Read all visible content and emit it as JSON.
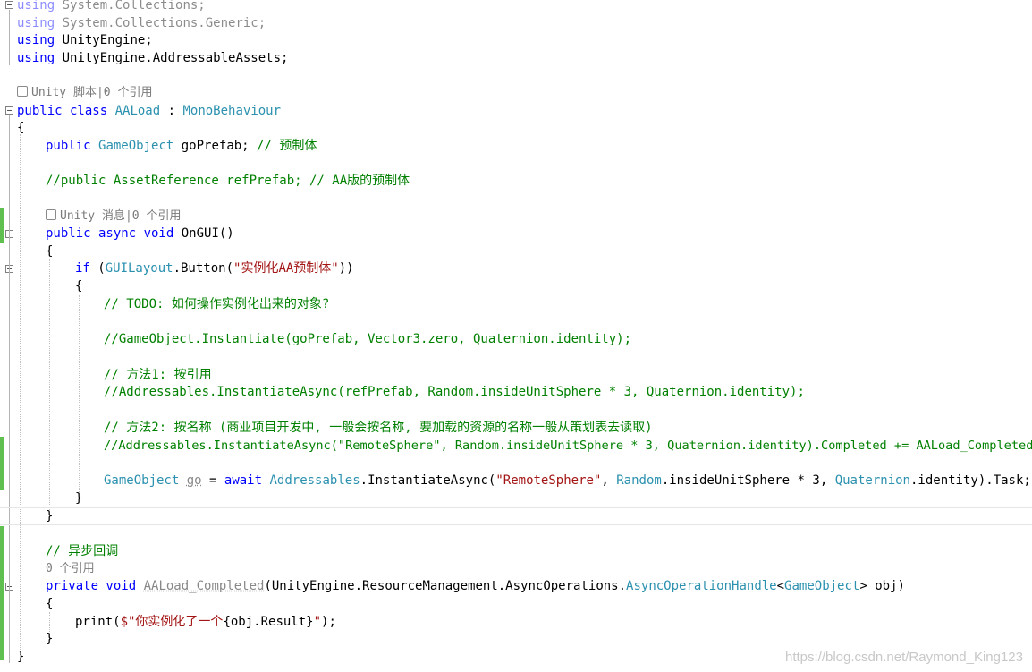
{
  "lines": {
    "l1_kw": "using",
    "l1_rest": " System.Collections;",
    "l2_kw": "using",
    "l2_rest": " System.Collections.Generic;",
    "l3_kw": "using",
    "l3_rest": " UnityEngine;",
    "l4_kw": "using",
    "l4_rest": " UnityEngine.AddressableAssets;",
    "lens1": "Unity 脚本|0 个引用",
    "l6_kw": "public class",
    "l6_type": "AALoad",
    "l6_sep": " : ",
    "l6_base": "MonoBehaviour",
    "l7": "{",
    "l8_kw": "public",
    "l8_type": "GameObject",
    "l8_rest": " goPrefab; ",
    "l8_cmt": "// 预制体",
    "l10_cmt": "//public AssetReference refPrefab; // AA版的预制体",
    "lens2": "Unity 消息|0 个引用",
    "l12_kw": "public async void",
    "l12_rest": " OnGUI()",
    "l13": "{",
    "l14_kw": "if",
    "l14_a": " (",
    "l14_type": "GUILayout",
    "l14_b": ".Button(",
    "l14_str": "\"实例化AA预制体\"",
    "l14_c": "))",
    "l15": "{",
    "l16_cmt": "// TODO: 如何操作实例化出来的对象?",
    "l18_cmt": "//GameObject.Instantiate(goPrefab, Vector3.zero, Quaternion.identity);",
    "l20_cmt": "// 方法1: 按引用",
    "l21_cmt": "//Addressables.InstantiateAsync(refPrefab, Random.insideUnitSphere * 3, Quaternion.identity);",
    "l23_cmt": "// 方法2: 按名称 (商业项目开发中, 一般会按名称, 要加载的资源的名称一般从策划表去读取)",
    "l24_cmt": "//Addressables.InstantiateAsync(\"RemoteSphere\", Random.insideUnitSphere * 3, Quaternion.identity).Completed += AALoad_Completed;",
    "l26_type": "GameObject",
    "l26_var": "go",
    "l26_eq": " = ",
    "l26_kw": "await",
    "l26_type2": "Addressables",
    "l26_a": ".InstantiateAsync(",
    "l26_str": "\"RemoteSphere\"",
    "l26_b": ", ",
    "l26_type3": "Random",
    "l26_c": ".insideUnitSphere * 3, ",
    "l26_type4": "Quaternion",
    "l26_d": ".identity).Task;",
    "l27": "}",
    "l28": "}",
    "l30_cmt": "// 异步回调",
    "lens3": "0 个引用",
    "l32_kw": "private void",
    "l32_name": "AALoad_Completed",
    "l32_a": "(UnityEngine.ResourceManagement.AsyncOperations.",
    "l32_type": "AsyncOperationHandle",
    "l32_b": "<",
    "l32_type2": "GameObject",
    "l32_c": "> obj)",
    "l33": "{",
    "l34_a": "print(",
    "l34_str": "$\"你实例化了一个",
    "l34_b": "{obj.Result}",
    "l34_str2": "\"",
    "l34_c": ");",
    "l35": "}",
    "l36": "}"
  },
  "watermark": "https://blog.csdn.net/Raymond_King123",
  "colors": {
    "keyword": "#0000ff",
    "type": "#2b91af",
    "comment": "#008000",
    "string": "#a31515",
    "change_bar": "#5fbf4f"
  }
}
